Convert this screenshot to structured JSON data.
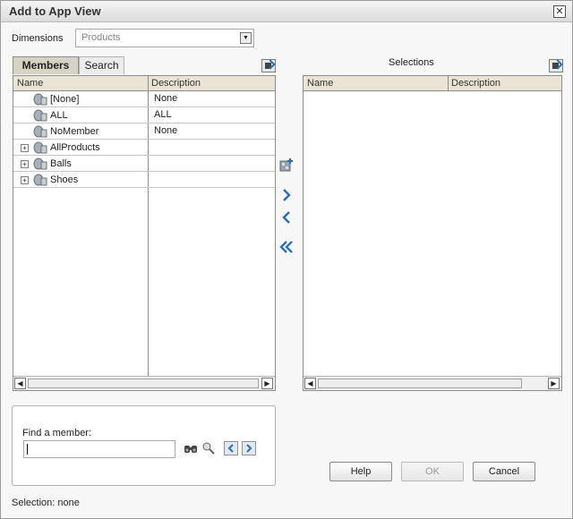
{
  "window": {
    "title": "Add to App View"
  },
  "dimensions": {
    "label": "Dimensions",
    "selected": "Products"
  },
  "tabs": {
    "members": "Members",
    "search": "Search"
  },
  "members_grid": {
    "columns": [
      "Name",
      "Description"
    ],
    "rows": [
      {
        "name": "[None]",
        "description": "None",
        "expandable": false
      },
      {
        "name": "ALL",
        "description": "ALL",
        "expandable": false
      },
      {
        "name": "NoMember",
        "description": "None",
        "expandable": false
      },
      {
        "name": "AllProducts",
        "description": "",
        "expandable": true
      },
      {
        "name": "Balls",
        "description": "",
        "expandable": true
      },
      {
        "name": "Shoes",
        "description": "",
        "expandable": true
      }
    ]
  },
  "selections": {
    "title": "Selections",
    "columns": [
      "Name",
      "Description"
    ],
    "rows": []
  },
  "find": {
    "label": "Find a member:",
    "value": ""
  },
  "buttons": {
    "help": "Help",
    "ok": "OK",
    "cancel": "Cancel"
  },
  "status": {
    "text": "Selection: none"
  },
  "icons": {
    "close": "close-icon",
    "dropdown": "chevron-down-icon",
    "export": "export-icon",
    "add_special": "add-special-icon",
    "add": "chevron-right-icon",
    "remove": "chevron-left-icon",
    "remove_all": "double-chevron-left-icon",
    "binoculars": "binoculars-icon",
    "find_person": "find-member-icon",
    "prev": "previous-icon",
    "next": "next-icon"
  },
  "colors": {
    "tab_active": "#d7d3c4",
    "header": "#e9e4d6",
    "arrow_blue": "#2b6fb8"
  }
}
